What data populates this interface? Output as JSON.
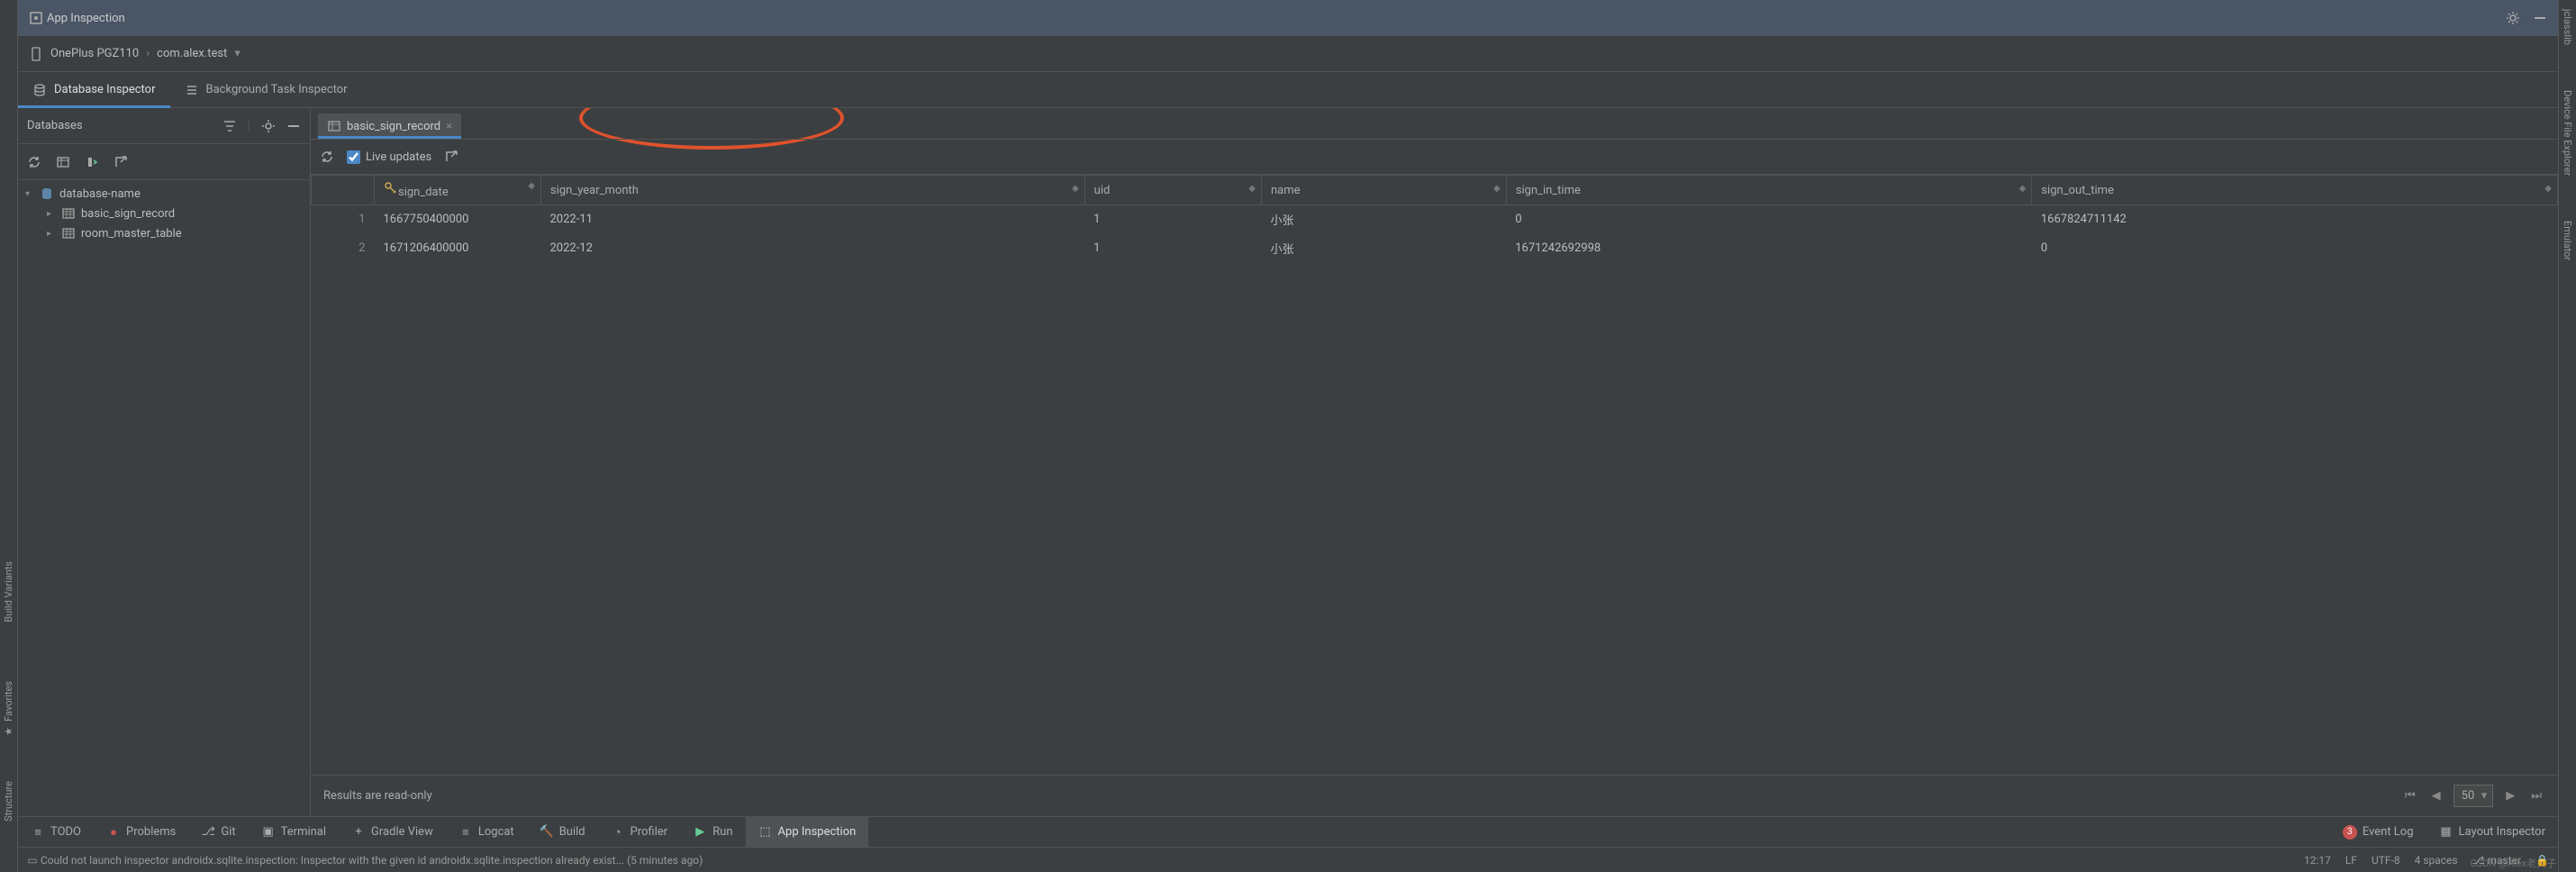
{
  "title": "App Inspection",
  "device": {
    "name": "OnePlus PGZ110",
    "app": "com.alex.test"
  },
  "side_tabs": [
    "Database Inspector",
    "Background Task Inspector"
  ],
  "databases": {
    "label": "Databases",
    "root": "database-name",
    "tables": [
      "basic_sign_record",
      "room_master_table"
    ]
  },
  "editor": {
    "tab_name": "basic_sign_record",
    "live_updates_label": "Live updates",
    "live_updates_checked": true,
    "columns": [
      "sign_date",
      "sign_year_month",
      "uid",
      "name",
      "sign_in_time",
      "sign_out_time"
    ],
    "rows": [
      {
        "n": "1",
        "sign_date": "1667750400000",
        "sign_year_month": "2022-11",
        "uid": "1",
        "name": "小张",
        "sign_in_time": "0",
        "sign_out_time": "1667824711142"
      },
      {
        "n": "2",
        "sign_date": "1671206400000",
        "sign_year_month": "2022-12",
        "uid": "1",
        "name": "小张",
        "sign_in_time": "1671242692998",
        "sign_out_time": "0"
      }
    ],
    "footer_msg": "Results are read-only",
    "page_size": "50"
  },
  "bottom": {
    "items": [
      "TODO",
      "Problems",
      "Git",
      "Terminal",
      "Gradle View",
      "Logcat",
      "Build",
      "Profiler",
      "Run",
      "App Inspection"
    ],
    "right": {
      "badge": "3",
      "event_log": "Event Log",
      "layout_inspector": "Layout Inspector"
    }
  },
  "status": {
    "msg": "Could not launch inspector androidx.sqlite.inspection: Inspector with the given id androidx.sqlite.inspection already exist... (5 minutes ago)",
    "time": "12:17",
    "le": "LF",
    "enc": "UTF-8",
    "indent": "4 spaces",
    "branch": "master"
  },
  "left_rail": [
    "Build Variants",
    "Favorites",
    "Structure"
  ],
  "right_rail": [
    "jclasslib",
    "Device File Explorer",
    "Emulator"
  ],
  "watermark": "CSDN @Alex老夫子"
}
